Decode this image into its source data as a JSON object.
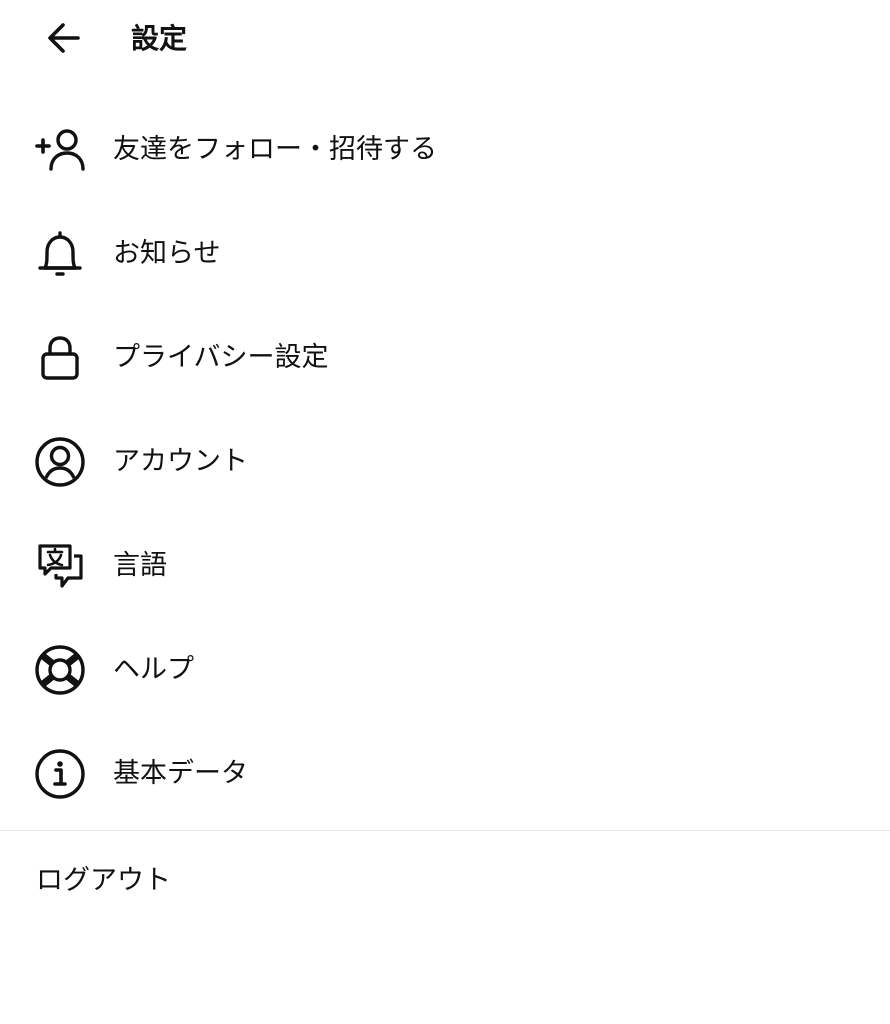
{
  "header": {
    "title": "設定",
    "back_icon": "arrow-left-icon"
  },
  "menu": {
    "items": [
      {
        "label": "友達をフォロー・招待する",
        "icon": "add-person-icon"
      },
      {
        "label": "お知らせ",
        "icon": "bell-icon"
      },
      {
        "label": "プライバシー設定",
        "icon": "lock-icon"
      },
      {
        "label": "アカウント",
        "icon": "account-circle-icon"
      },
      {
        "label": "言語",
        "icon": "translate-icon"
      },
      {
        "label": "ヘルプ",
        "icon": "lifebuoy-icon"
      },
      {
        "label": "基本データ",
        "icon": "info-icon"
      }
    ]
  },
  "footer": {
    "logout_label": "ログアウト"
  },
  "colors": {
    "text": "#111111",
    "background": "#ffffff",
    "divider": "#e6e6e6"
  }
}
